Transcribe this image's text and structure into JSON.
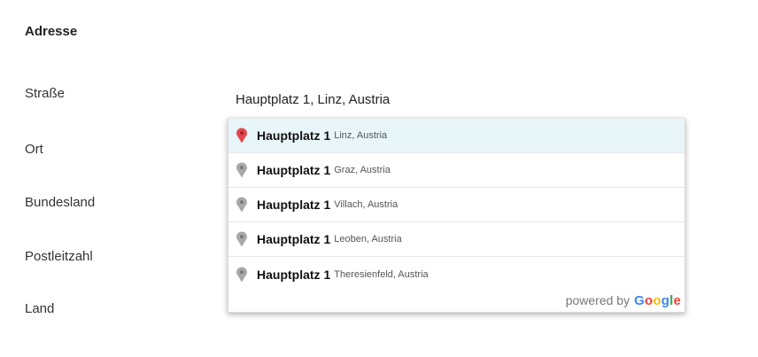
{
  "form": {
    "section_title": "Adresse",
    "labels": {
      "street": "Straße",
      "city": "Ort",
      "state": "Bundesland",
      "postal": "Postleitzahl",
      "country": "Land"
    },
    "street_value": "Hauptplatz 1, Linz, Austria",
    "country_value_partial": "——"
  },
  "autocomplete": {
    "items": [
      {
        "main": "Hauptplatz 1",
        "secondary": "Linz, Austria",
        "icon": "map-pin-red-icon",
        "active": true
      },
      {
        "main": "Hauptplatz 1",
        "secondary": "Graz, Austria",
        "icon": "map-pin-gray-icon",
        "active": false
      },
      {
        "main": "Hauptplatz 1",
        "secondary": "Villach, Austria",
        "icon": "map-pin-gray-icon",
        "active": false
      },
      {
        "main": "Hauptplatz 1",
        "secondary": "Leoben, Austria",
        "icon": "map-pin-gray-icon",
        "active": false
      },
      {
        "main": "Hauptplatz 1",
        "secondary": "Theresienfeld, Austria",
        "icon": "map-pin-gray-icon",
        "active": false
      }
    ],
    "powered_by": "powered by",
    "google_logo": "Google"
  },
  "colors": {
    "pin_active": "#e5464c",
    "pin_inactive": "#a8a8a8",
    "highlight": "#e8f6fa",
    "google": [
      "#4285F4",
      "#EA4335",
      "#FBBC05",
      "#4285F4",
      "#34A853",
      "#EA4335"
    ]
  }
}
